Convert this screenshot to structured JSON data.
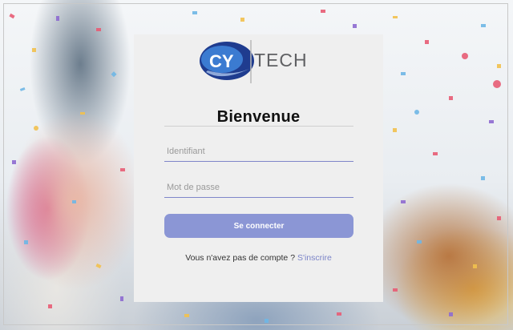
{
  "logo": {
    "monogram": "CY",
    "wordmark": "TECH",
    "brand_blue": "#1f3c8f",
    "brand_gray": "#5f6063"
  },
  "title": "Bienvenue",
  "form": {
    "username_placeholder": "Identifiant",
    "password_placeholder": "Mot de passe",
    "submit_label": "Se connecter"
  },
  "signup": {
    "prompt": "Vous n'avez pas de compte ?",
    "link_label": "S'inscrire"
  },
  "colors": {
    "accent": "#8b96d5",
    "link": "#7b84c8",
    "card": "#efefef",
    "field_underline": "#7f86c9"
  }
}
